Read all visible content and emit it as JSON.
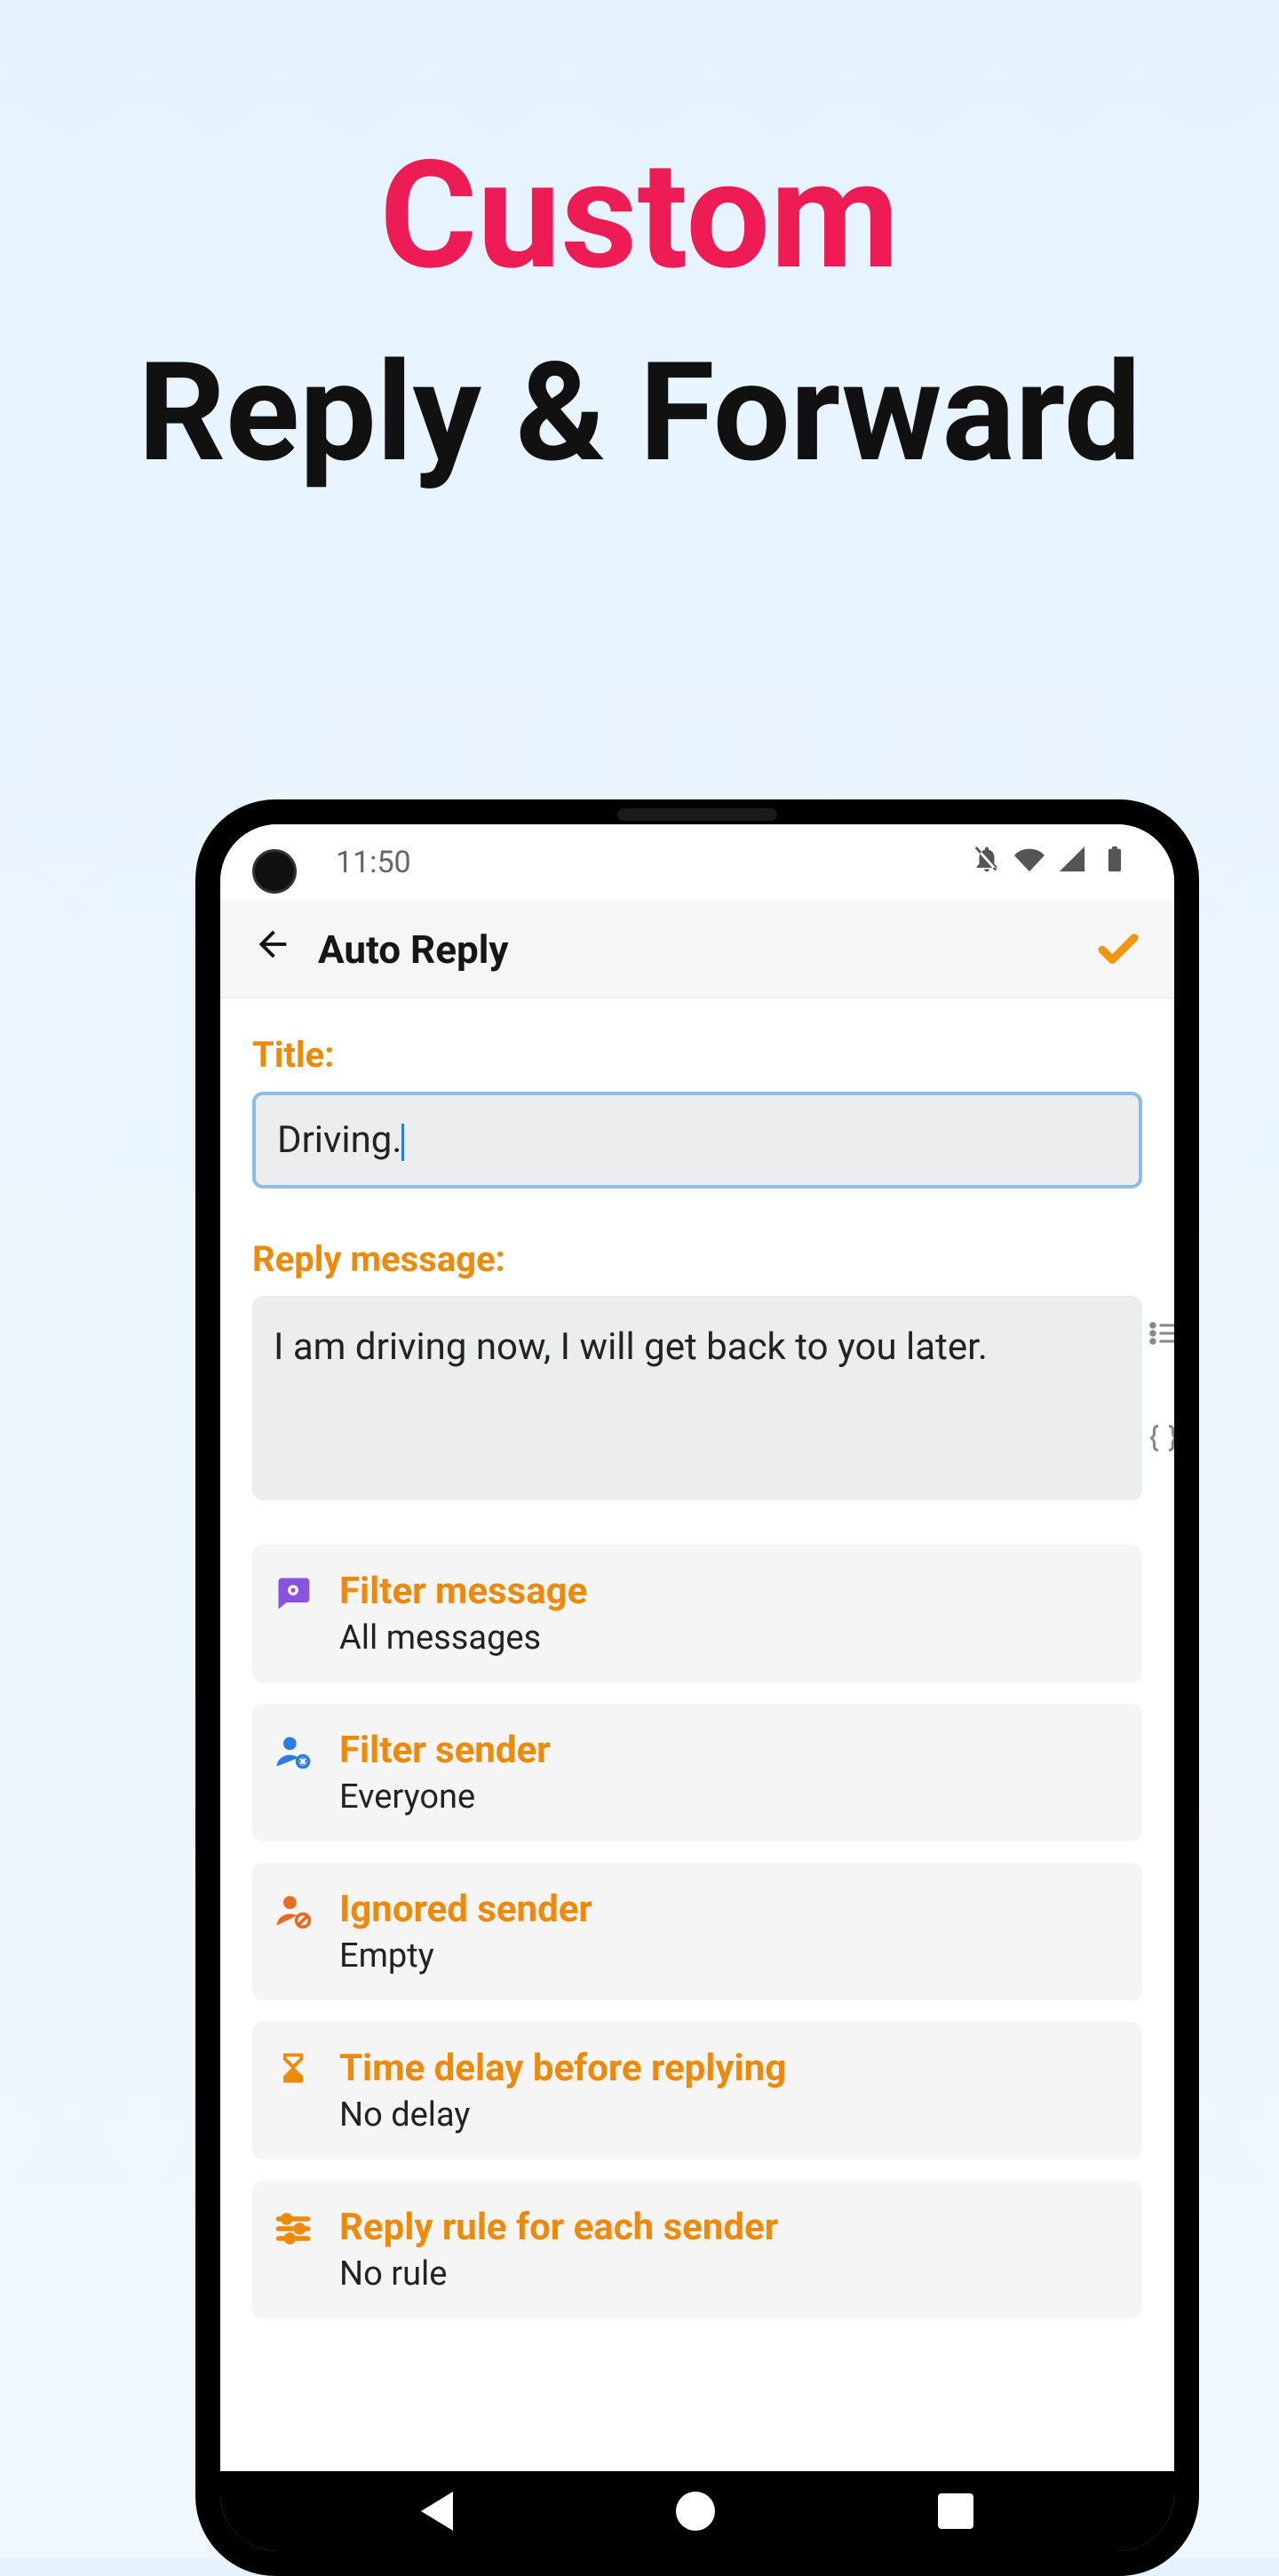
{
  "hero": {
    "line1": "Custom",
    "line2": "Reply & Forward"
  },
  "status": {
    "time": "11:50"
  },
  "appbar": {
    "title": "Auto Reply"
  },
  "form": {
    "title_label": "Title:",
    "title_value": "Driving.",
    "reply_label": "Reply message:",
    "reply_value": "I am driving now, I will get back to you later."
  },
  "options": [
    {
      "title": "Filter message",
      "sub": "All messages"
    },
    {
      "title": "Filter sender",
      "sub": "Everyone"
    },
    {
      "title": "Ignored sender",
      "sub": "Empty"
    },
    {
      "title": "Time delay before replying",
      "sub": "No delay"
    },
    {
      "title": "Reply rule for each sender",
      "sub": "No rule"
    }
  ]
}
